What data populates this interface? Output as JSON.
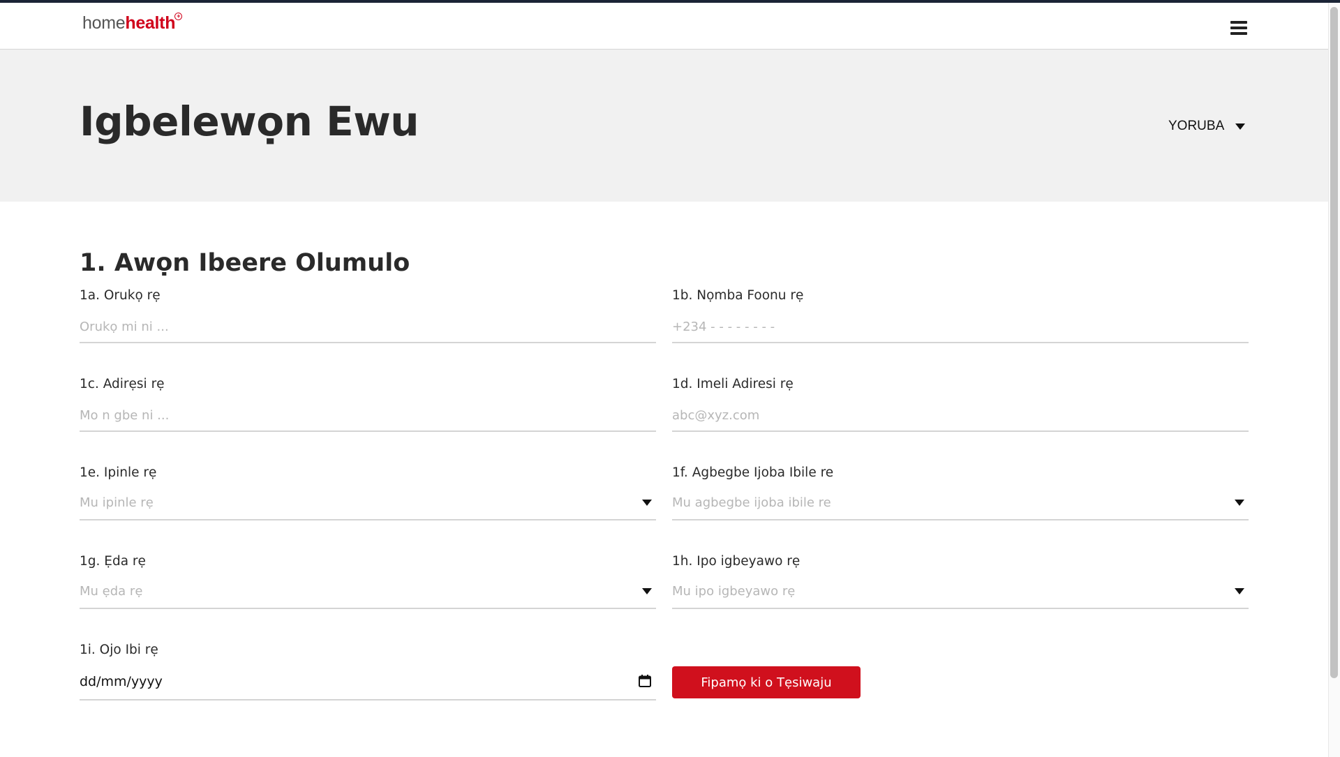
{
  "brand": {
    "logo_home": "home",
    "logo_health": "health",
    "logo_badge": "+"
  },
  "nav": {
    "menu_icon": "hamburger-menu-icon"
  },
  "header": {
    "title": "Igbelewọn Ewu",
    "language": "YORUBA"
  },
  "form": {
    "section_title": "1. Awọn Ibeere Olumulo",
    "fields": {
      "name": {
        "label": "1a. Orukọ rẹ",
        "placeholder": "Orukọ mi ni ..."
      },
      "phone": {
        "label": "1b. Nọmba Foonu rẹ",
        "placeholder": "+234 - - - - - - - -"
      },
      "address": {
        "label": "1c. Adirẹsi rẹ",
        "placeholder": "Mo n gbe ni ..."
      },
      "email": {
        "label": "1d. Imeli Adiresi rẹ",
        "placeholder": "abc@xyz.com"
      },
      "state": {
        "label": "1e. Ipinle rẹ",
        "placeholder": "Mu ipinle rẹ"
      },
      "lga": {
        "label": "1f. Agbegbe Ijoba Ibile re",
        "placeholder": "Mu agbegbe ijoba ibile re"
      },
      "gender": {
        "label": "1g. Ẹda rẹ",
        "placeholder": "Mu ẹda rẹ"
      },
      "marital": {
        "label": "1h. Ipo igbeyawo rẹ",
        "placeholder": "Mu ipo igbeyawo rẹ"
      },
      "dob": {
        "label": "1i. Ojo Ibi rẹ",
        "value": "dd/mm/yyyy"
      }
    },
    "submit_label": "Fipamọ ki o Tẹsiwaju"
  },
  "colors": {
    "brand_red": "#d0101d",
    "header_bg": "#f1f1f1",
    "topline": "#1b2436"
  }
}
